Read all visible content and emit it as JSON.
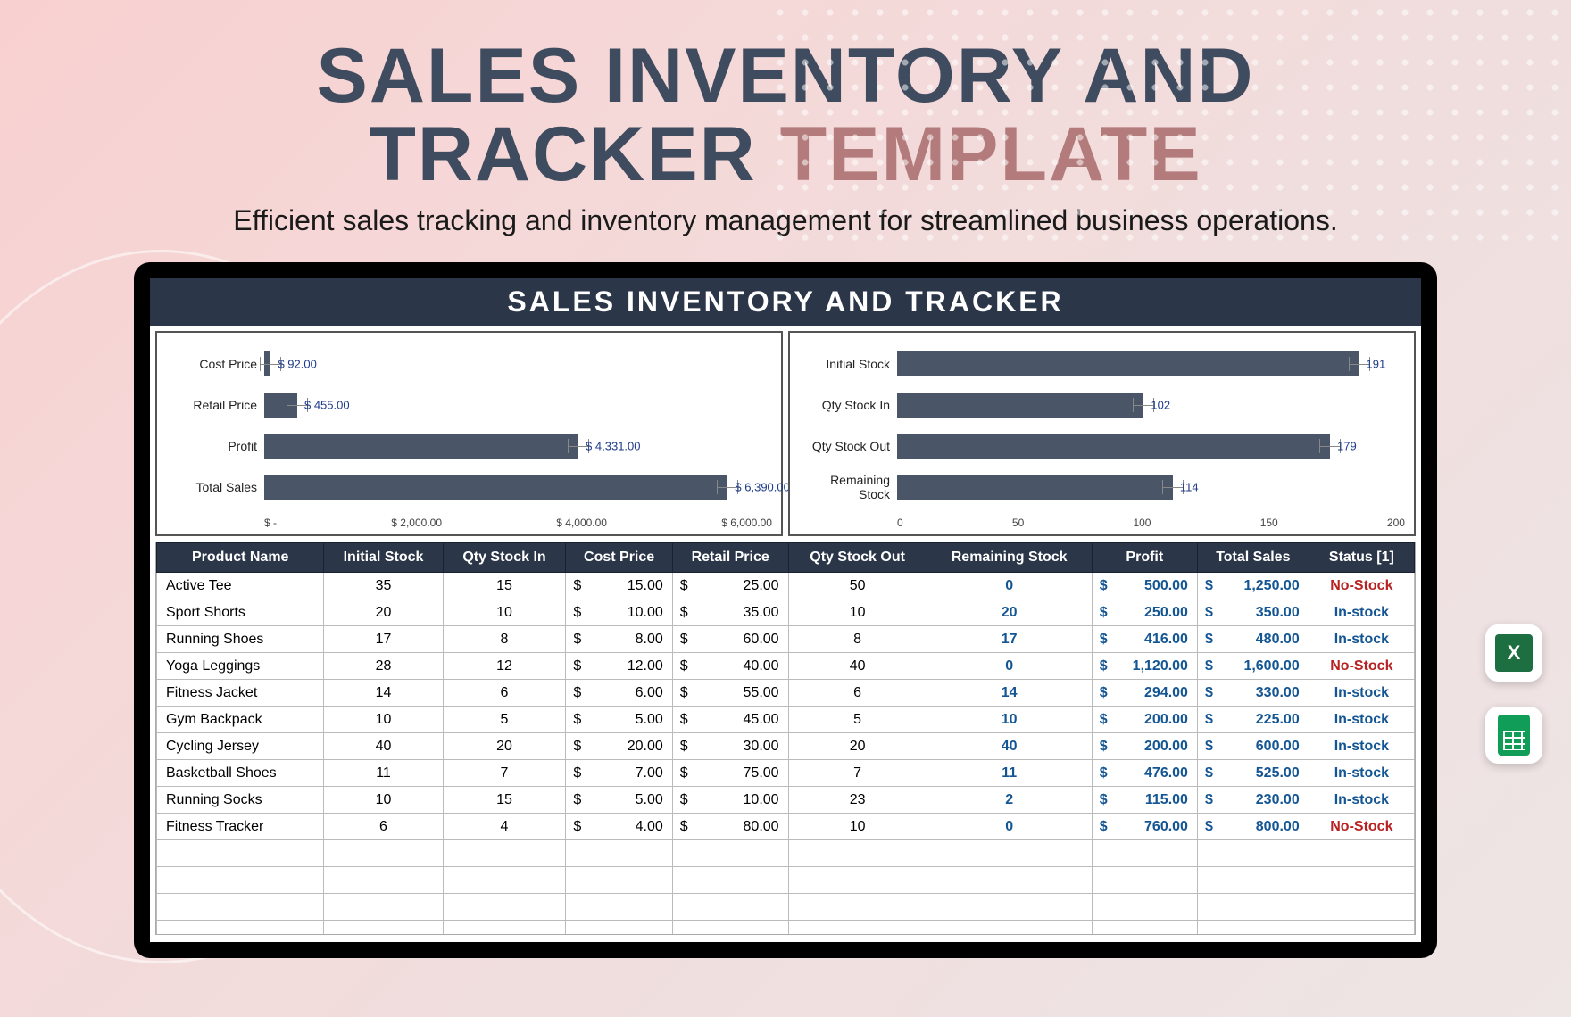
{
  "header": {
    "title_line1": "SALES INVENTORY AND",
    "title_line2_a": "TRACKER ",
    "title_line2_b": "TEMPLATE",
    "subtitle": "Efficient sales tracking and inventory management for streamlined business operations."
  },
  "banner": "SALES INVENTORY AND TRACKER",
  "chart_data": [
    {
      "type": "bar",
      "orientation": "horizontal",
      "categories": [
        "Cost Price",
        "Retail Price",
        "Profit",
        "Total Sales"
      ],
      "values": [
        92.0,
        455.0,
        4331.0,
        6390.0
      ],
      "value_labels": [
        "$ 92.00",
        "$ 455.00",
        "$ 4,331.00",
        "$ 6,390.00"
      ],
      "xlabel": "",
      "xlim": [
        0,
        7000
      ],
      "xticks": [
        "$ -",
        "$ 2,000.00",
        "$ 4,000.00",
        "$ 6,000.00"
      ]
    },
    {
      "type": "bar",
      "orientation": "horizontal",
      "categories": [
        "Initial Stock",
        "Qty Stock In",
        "Qty Stock Out",
        "Remaining Stock"
      ],
      "values": [
        191,
        102,
        179,
        114
      ],
      "value_labels": [
        "191",
        "102",
        "179",
        "114"
      ],
      "xlabel": "",
      "xlim": [
        0,
        210
      ],
      "xticks": [
        "0",
        "50",
        "100",
        "150",
        "200"
      ]
    }
  ],
  "table": {
    "headers": [
      "Product Name",
      "Initial Stock",
      "Qty Stock In",
      "Cost Price",
      "Retail Price",
      "Qty Stock Out",
      "Remaining Stock",
      "Profit",
      "Total Sales",
      "Status [1]"
    ],
    "rows": [
      {
        "name": "Active Tee",
        "initial": 35,
        "in": 15,
        "cost": "15.00",
        "retail": "25.00",
        "out": 50,
        "remain": 0,
        "profit": "500.00",
        "sales": "1,250.00",
        "status": "No-Stock"
      },
      {
        "name": "Sport Shorts",
        "initial": 20,
        "in": 10,
        "cost": "10.00",
        "retail": "35.00",
        "out": 10,
        "remain": 20,
        "profit": "250.00",
        "sales": "350.00",
        "status": "In-stock"
      },
      {
        "name": "Running Shoes",
        "initial": 17,
        "in": 8,
        "cost": "8.00",
        "retail": "60.00",
        "out": 8,
        "remain": 17,
        "profit": "416.00",
        "sales": "480.00",
        "status": "In-stock"
      },
      {
        "name": "Yoga Leggings",
        "initial": 28,
        "in": 12,
        "cost": "12.00",
        "retail": "40.00",
        "out": 40,
        "remain": 0,
        "profit": "1,120.00",
        "sales": "1,600.00",
        "status": "No-Stock"
      },
      {
        "name": "Fitness Jacket",
        "initial": 14,
        "in": 6,
        "cost": "6.00",
        "retail": "55.00",
        "out": 6,
        "remain": 14,
        "profit": "294.00",
        "sales": "330.00",
        "status": "In-stock"
      },
      {
        "name": "Gym Backpack",
        "initial": 10,
        "in": 5,
        "cost": "5.00",
        "retail": "45.00",
        "out": 5,
        "remain": 10,
        "profit": "200.00",
        "sales": "225.00",
        "status": "In-stock"
      },
      {
        "name": "Cycling Jersey",
        "initial": 40,
        "in": 20,
        "cost": "20.00",
        "retail": "30.00",
        "out": 20,
        "remain": 40,
        "profit": "200.00",
        "sales": "600.00",
        "status": "In-stock"
      },
      {
        "name": "Basketball Shoes",
        "initial": 11,
        "in": 7,
        "cost": "7.00",
        "retail": "75.00",
        "out": 7,
        "remain": 11,
        "profit": "476.00",
        "sales": "525.00",
        "status": "In-stock"
      },
      {
        "name": "Running Socks",
        "initial": 10,
        "in": 15,
        "cost": "5.00",
        "retail": "10.00",
        "out": 23,
        "remain": 2,
        "profit": "115.00",
        "sales": "230.00",
        "status": "In-stock"
      },
      {
        "name": "Fitness Tracker",
        "initial": 6,
        "in": 4,
        "cost": "4.00",
        "retail": "80.00",
        "out": 10,
        "remain": 0,
        "profit": "760.00",
        "sales": "800.00",
        "status": "No-Stock"
      }
    ]
  },
  "icons": {
    "excel": "excel-icon",
    "sheets": "google-sheets-icon"
  }
}
